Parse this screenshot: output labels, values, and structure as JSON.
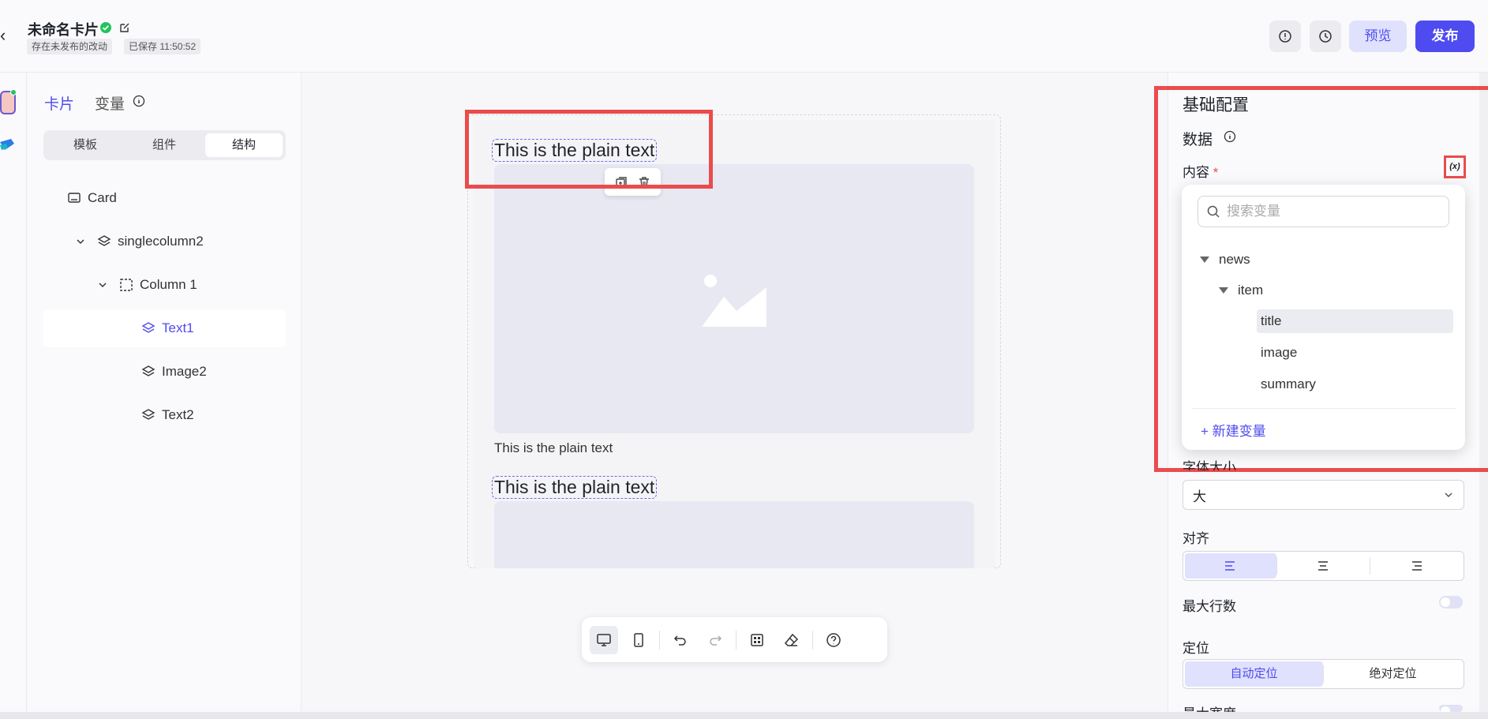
{
  "header": {
    "title": "未命名卡片",
    "tag_unpublished": "存在未发布的改动",
    "tag_saved": "已保存 11:50:52",
    "preview_label": "预览",
    "publish_label": "发布"
  },
  "left_panel": {
    "tab_card": "卡片",
    "tab_variable": "变量",
    "segments": [
      "模板",
      "组件",
      "结构"
    ],
    "active_segment": "结构",
    "tree": [
      {
        "label": "Card",
        "icon": "card-icon",
        "level": 0
      },
      {
        "label": "singlecolumn2",
        "icon": "layers-icon",
        "level": 1,
        "expanded": true
      },
      {
        "label": "Column 1",
        "icon": "column-icon",
        "level": 2,
        "expanded": true
      },
      {
        "label": "Text1",
        "icon": "layers-icon",
        "level": 3,
        "selected": true
      },
      {
        "label": "Image2",
        "icon": "layers-icon",
        "level": 3
      },
      {
        "label": "Text2",
        "icon": "layers-icon",
        "level": 3
      }
    ]
  },
  "canvas": {
    "text1": "This is the plain text",
    "caption": "This is the plain text",
    "text2": "This is the plain text"
  },
  "right_panel": {
    "section_title": "基础配置",
    "data_label": "数据",
    "content_label": "内容",
    "required_mark": "*",
    "var_button": "(x)",
    "dropdown": {
      "search_placeholder": "搜索变量",
      "tree": [
        {
          "label": "news",
          "level": 0
        },
        {
          "label": "item",
          "level": 1
        },
        {
          "label": "title",
          "level": 2,
          "selected": true
        },
        {
          "label": "image",
          "level": 2
        },
        {
          "label": "summary",
          "level": 2
        }
      ],
      "new_variable": "+ 新建变量"
    },
    "font_size_label": "字体大小",
    "font_size_value": "大",
    "align_label": "对齐",
    "max_lines_label": "最大行数",
    "position_label": "定位",
    "position_options": [
      "自动定位",
      "绝对定位"
    ],
    "position_active": "自动定位",
    "max_width_label": "最大宽度"
  },
  "colors": {
    "accent": "#4e4bf0",
    "highlight_box": "#ea4c4c",
    "success": "#21c45d"
  }
}
